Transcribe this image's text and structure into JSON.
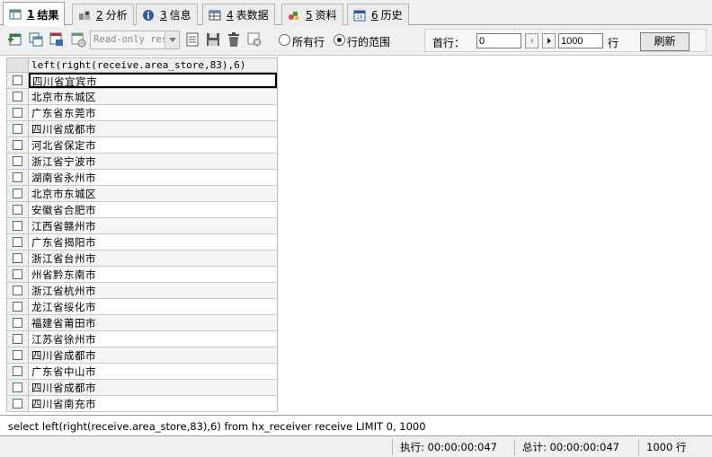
{
  "tabs": [
    {
      "num": "1",
      "label": "结果",
      "icon": "result-grid-icon"
    },
    {
      "num": "2",
      "label": "分析",
      "icon": "profiler-icon"
    },
    {
      "num": "3",
      "label": "信息",
      "icon": "info-icon"
    },
    {
      "num": "4",
      "label": "表数据",
      "icon": "table-data-icon"
    },
    {
      "num": "5",
      "label": "资料",
      "icon": "shapes-icon"
    },
    {
      "num": "6",
      "label": "历史",
      "icon": "history-calendar-icon"
    }
  ],
  "toolbar": {
    "readonly_value": "Read-only res",
    "radio_all_rows": "所有行",
    "radio_row_range": "行的范围",
    "first_row_label": "首行：",
    "first_row_value": "0",
    "row_count_value": "1000",
    "row_suffix": "行",
    "refresh_label": "刷新",
    "selected_radio": "row_range"
  },
  "grid": {
    "column_header": "left(right(receive.area_store,83),6)",
    "rows": [
      "四川省宜宾市",
      "北京市东城区",
      "广东省东莞市",
      "四川省成都市",
      "河北省保定市",
      "浙江省宁波市",
      "湖南省永州市",
      "北京市东城区",
      "安徽省合肥市",
      "江西省赣州市",
      "广东省揭阳市",
      "浙江省台州市",
      "州省黔东南市",
      "浙江省杭州市",
      "龙江省绥化市",
      "福建省莆田市",
      "江苏省徐州市",
      "四川省成都市",
      "广东省中山市",
      "四川省成都市",
      "四川省南充市"
    ]
  },
  "query": "select left(right(receive.area_store,83),6)  from hx_receiver receive  LIMIT 0, 1000",
  "status": {
    "exec": "执行: 00:00:00:047",
    "total": "总计: 00:00:00:047",
    "rows": "1000 行"
  }
}
